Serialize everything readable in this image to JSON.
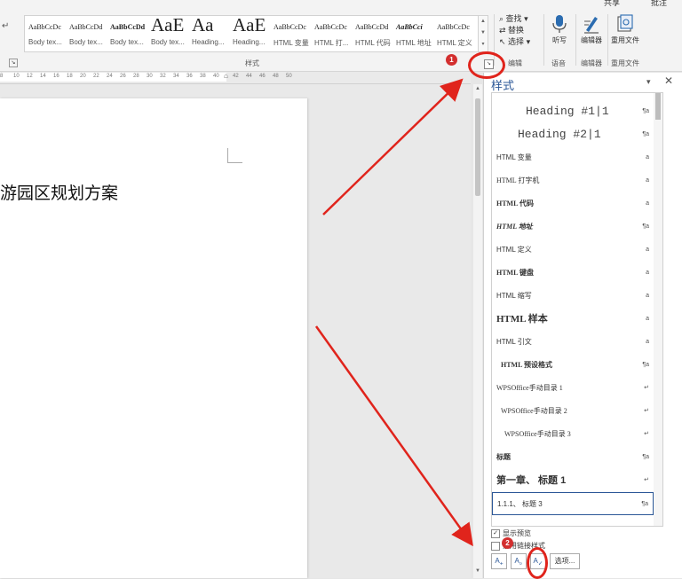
{
  "window": {
    "share_label": "共享",
    "comments_label": "批注"
  },
  "ribbon": {
    "style_gallery": [
      {
        "preview": "AaBbCcDc",
        "name": "Body tex...",
        "kind": "small"
      },
      {
        "preview": "AaBbCcDd",
        "name": "Body tex...",
        "kind": "small"
      },
      {
        "preview": "AaBbCcDd",
        "name": "Body tex...",
        "kind": "bold"
      },
      {
        "preview": "AaE",
        "name": "Body tex...",
        "kind": "big"
      },
      {
        "preview": "Aa",
        "name": "Heading...",
        "kind": "big"
      },
      {
        "preview": "AaE",
        "name": "Heading...",
        "kind": "big"
      },
      {
        "preview": "AaBbCcDc",
        "name": "HTML 变量",
        "kind": "small"
      },
      {
        "preview": "AaBbCcDc",
        "name": "HTML 打...",
        "kind": "small"
      },
      {
        "preview": "AaBbCcDd",
        "name": "HTML 代码",
        "kind": "small"
      },
      {
        "preview": "AaBbCci",
        "name": "HTML 地址",
        "kind": "bi"
      },
      {
        "preview": "AaBbCcDc",
        "name": "HTML 定义",
        "kind": "small"
      }
    ],
    "styles_group_label": "样式",
    "editing": {
      "find": "查找",
      "replace": "替换",
      "select": "选择",
      "group_label": "编辑"
    },
    "dictate": {
      "label": "听写",
      "group_label": "语音"
    },
    "editor": {
      "label": "编辑器",
      "group_label": "编辑器"
    },
    "reuse": {
      "label": "重用文件",
      "group_label": "重用文件"
    }
  },
  "ruler": {
    "ticks": [
      "8",
      "10",
      "12",
      "14",
      "16",
      "18",
      "20",
      "22",
      "24",
      "26",
      "28",
      "30",
      "32",
      "34",
      "36",
      "38",
      "40",
      "42",
      "44",
      "46",
      "48",
      "50"
    ]
  },
  "document": {
    "title_fragment": "游园区规划方案"
  },
  "styles_pane": {
    "title": "样式",
    "menu_icon": "chevron-down-icon",
    "close_icon": "close-icon",
    "items": [
      {
        "label": "Heading #1|1",
        "type": "¶a"
      },
      {
        "label": "Heading #2|1",
        "type": "¶a"
      },
      {
        "label": "HTML 变量",
        "type": "a"
      },
      {
        "label": "HTML 打字机",
        "type": "a"
      },
      {
        "label": "HTML 代码",
        "type": "a"
      },
      {
        "label": "HTML 地址",
        "type": "¶a"
      },
      {
        "label": "HTML 定义",
        "type": "a"
      },
      {
        "label": "HTML 键盘",
        "type": "a"
      },
      {
        "label": "HTML 缩写",
        "type": "a"
      },
      {
        "label": "HTML 样本",
        "type": "a"
      },
      {
        "label": "HTML 引文",
        "type": "a"
      },
      {
        "label": "HTML 预设格式",
        "type": "¶a"
      },
      {
        "label": "WPSOffice手动目录 1",
        "type": "↵"
      },
      {
        "label": "WPSOffice手动目录 2",
        "type": "↵"
      },
      {
        "label": "WPSOffice手动目录 3",
        "type": "↵"
      },
      {
        "label": "标题",
        "type": "¶a"
      },
      {
        "label": "第一章、  标题 1",
        "type": "↵"
      },
      {
        "label": "1.1.1、  标题 3",
        "type": "¶a"
      }
    ],
    "show_preview_label": "显示预览",
    "disable_linked_label": "禁用链接样式",
    "options_label": "选项..."
  },
  "annotations": {
    "badge_1": "1",
    "badge_2": "2"
  },
  "colors": {
    "accent": "#2b5797",
    "annotation_red": "#e0241c",
    "badge_red": "#d32f2f"
  }
}
